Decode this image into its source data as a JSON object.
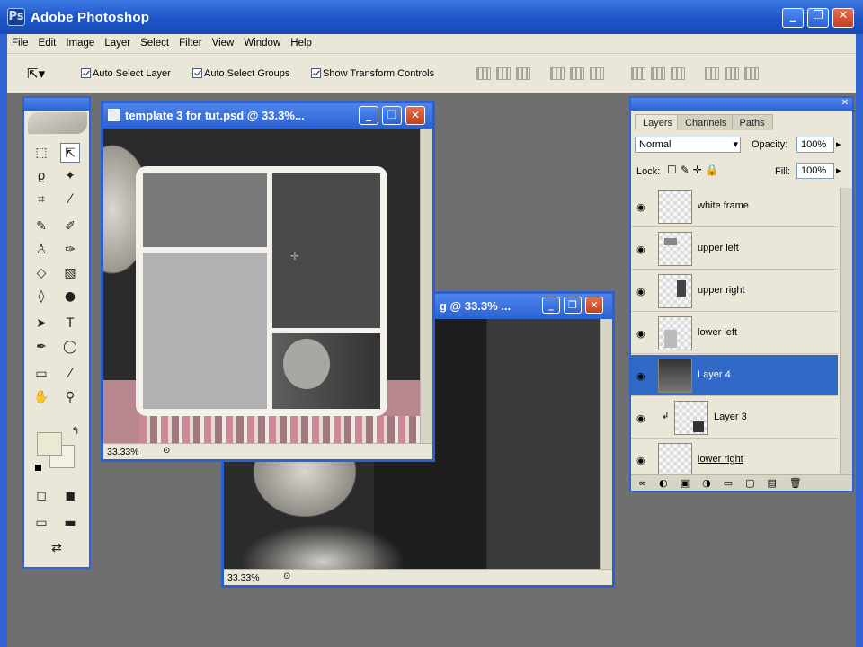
{
  "app": {
    "title": "Adobe Photoshop",
    "icon": "ps-icon"
  },
  "menu": [
    "File",
    "Edit",
    "Image",
    "Layer",
    "Select",
    "Filter",
    "View",
    "Window",
    "Help"
  ],
  "options": {
    "auto_select_layer": "Auto Select Layer",
    "auto_select_groups": "Auto Select Groups",
    "show_transform_controls": "Show Transform Controls"
  },
  "doc_front": {
    "title": "template 3 for tut.psd @ 33.3%...",
    "zoom": "33.33%"
  },
  "doc_back": {
    "title": "g @ 33.3% ...",
    "zoom": "33.33%"
  },
  "layers": {
    "tabs": [
      "Layers",
      "Channels",
      "Paths"
    ],
    "blend_mode": "Normal",
    "opacity_label": "Opacity:",
    "opacity_value": "100%",
    "lock_label": "Lock:",
    "fill_label": "Fill:",
    "fill_value": "100%",
    "items": [
      {
        "name": "white frame",
        "selected": false
      },
      {
        "name": "upper left",
        "selected": false
      },
      {
        "name": "upper right",
        "selected": false
      },
      {
        "name": "lower left",
        "selected": false
      },
      {
        "name": "Layer 4",
        "selected": true
      },
      {
        "name": "Layer 3",
        "selected": false
      },
      {
        "name": "lower right",
        "selected": false
      }
    ]
  },
  "colors": {
    "accent": "#2f62d3",
    "panel": "#ebe7d8",
    "selection": "#3169c6"
  }
}
